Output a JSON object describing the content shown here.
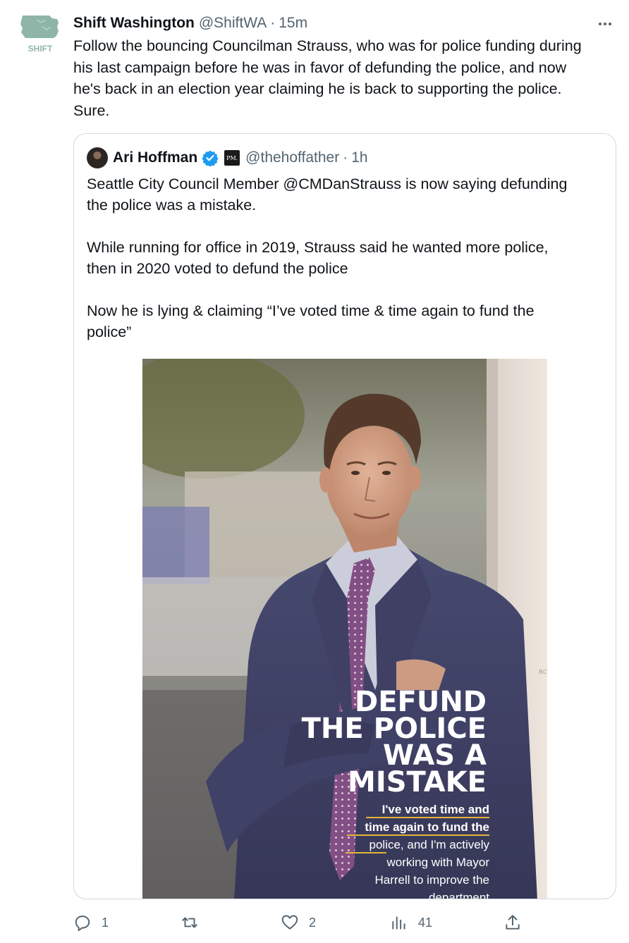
{
  "tweet": {
    "author_name": "Shift Washington",
    "author_handle": "@ShiftWA",
    "separator": "·",
    "time": "15m",
    "avatar_label": "SHIFT",
    "text": "Follow the bouncing Councilman Strauss, who was for police funding during\nhis last campaign before he was in favor of defunding the police, and now\nhe's back in an election year claiming he is back to supporting the police.\nSure."
  },
  "quote": {
    "author_name": "Ari Hoffman",
    "badge_text": "PM.",
    "author_handle": "@thehoffather",
    "separator": "·",
    "time": "1h",
    "text": "Seattle City Council Member @CMDanStrauss is now saying defunding\nthe police was a mistake.\n\nWhile running for office in 2019, Strauss said he wanted more police,\nthen in 2020 voted to defund the police\n\nNow he is lying & claiming “I’ve voted time & time again to fund the\npolice”",
    "image": {
      "headline_lines": [
        "DEFUND",
        "THE POLICE",
        "WAS A",
        "MISTAKE"
      ],
      "caption_lines": [
        "I've voted time and",
        "time again to fund the",
        "police, and I'm actively",
        "working with Mayor",
        "Harrell to improve the",
        "department"
      ],
      "side_letters": [
        "BC"
      ]
    }
  },
  "actions": {
    "reply_count": "1",
    "retweet_count": "",
    "like_count": "2",
    "views_count": "41"
  },
  "colors": {
    "text": "#0f1419",
    "muted": "#536471",
    "border": "#cfd9de",
    "verified": "#1d9bf0",
    "brand": "#8fb5a8"
  },
  "icons": [
    "more-icon",
    "verified-badge-icon",
    "reply-icon",
    "retweet-icon",
    "like-icon",
    "views-icon",
    "share-icon"
  ]
}
